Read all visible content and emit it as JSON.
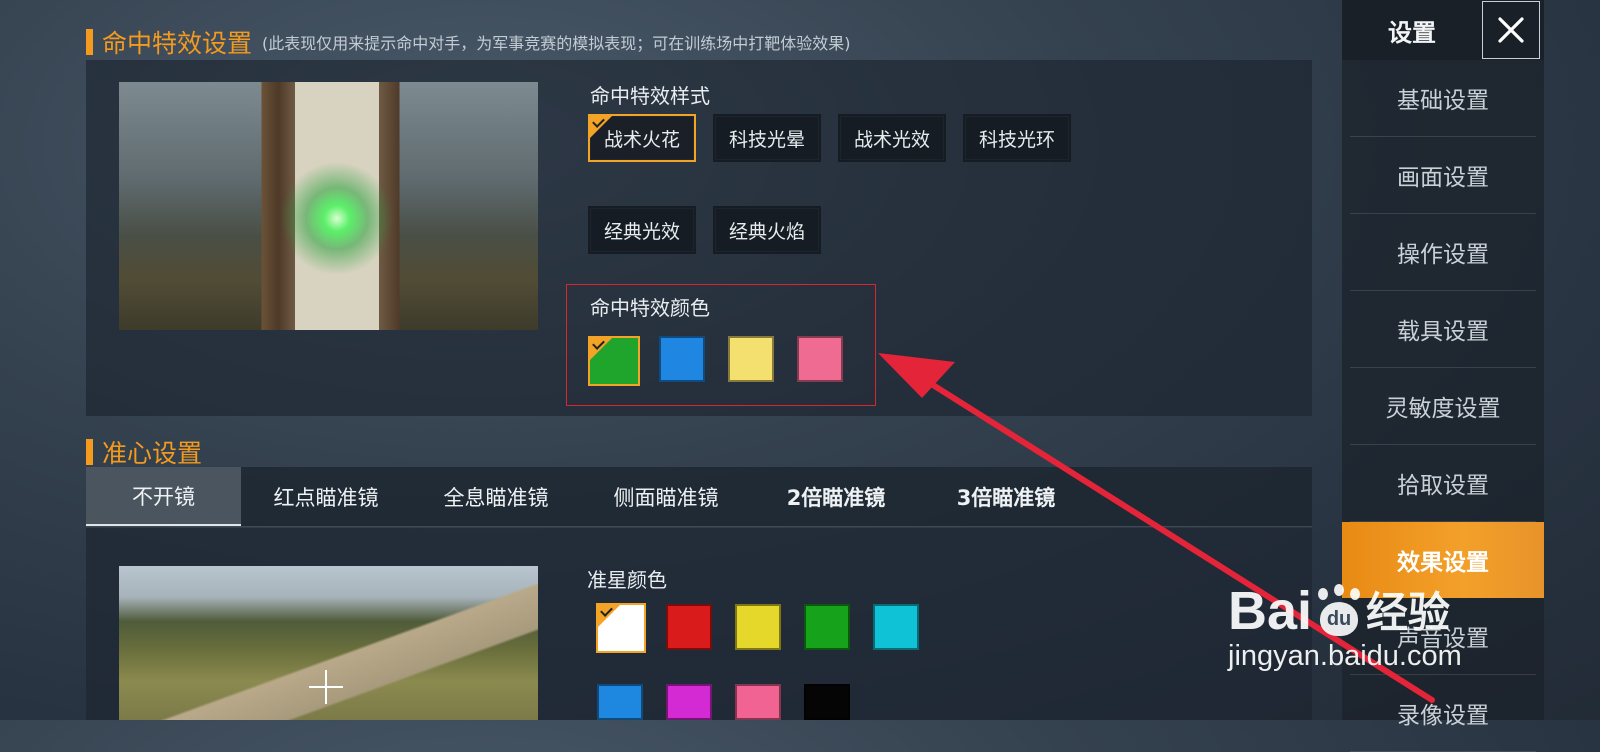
{
  "hit_effect": {
    "title": "命中特效设置",
    "subtitle": "(此表现仅用来提示命中对手，为军事竞赛的模拟表现；可在训练场中打靶体验效果)",
    "style_label": "命中特效样式",
    "styles": [
      "战术火花",
      "科技光晕",
      "战术光效",
      "科技光环",
      "经典光效",
      "经典火焰"
    ],
    "selected_style": "战术火花",
    "color_label": "命中特效颜色",
    "colors": [
      "#1fa52b",
      "#1f87e2",
      "#f4e06e",
      "#f06b91"
    ],
    "selected_color_index": 0
  },
  "crosshair": {
    "title": "准心设置",
    "tabs": [
      "不开镜",
      "红点瞄准镜",
      "全息瞄准镜",
      "侧面瞄准镜",
      "2倍瞄准镜",
      "3倍瞄准镜"
    ],
    "active_tab": "不开镜",
    "color_label": "准星颜色",
    "colors_row1": [
      "#ffffff",
      "#d91b1b",
      "#e6d82a",
      "#17a21b",
      "#10c2d6"
    ],
    "colors_row2": [
      "#1e88e0",
      "#d42ad4",
      "#f06392",
      "#050505"
    ],
    "selected_color_index": 0
  },
  "sidebar": {
    "title": "设置",
    "close_icon": "close-icon",
    "items": [
      {
        "label": "基础设置"
      },
      {
        "label": "画面设置"
      },
      {
        "label": "操作设置"
      },
      {
        "label": "载具设置"
      },
      {
        "label": "灵敏度设置"
      },
      {
        "label": "拾取设置"
      },
      {
        "label": "效果设置"
      },
      {
        "label": "声音设置"
      },
      {
        "label": "录像设置"
      }
    ],
    "active_index": 6
  },
  "watermark": {
    "brand": "Bai",
    "brand_mid": "du",
    "brand_cn": "经验",
    "url": "jingyan.baidu.com"
  },
  "annotation": {
    "box_color": "#d8262d",
    "arrow_color": "#e32439"
  }
}
